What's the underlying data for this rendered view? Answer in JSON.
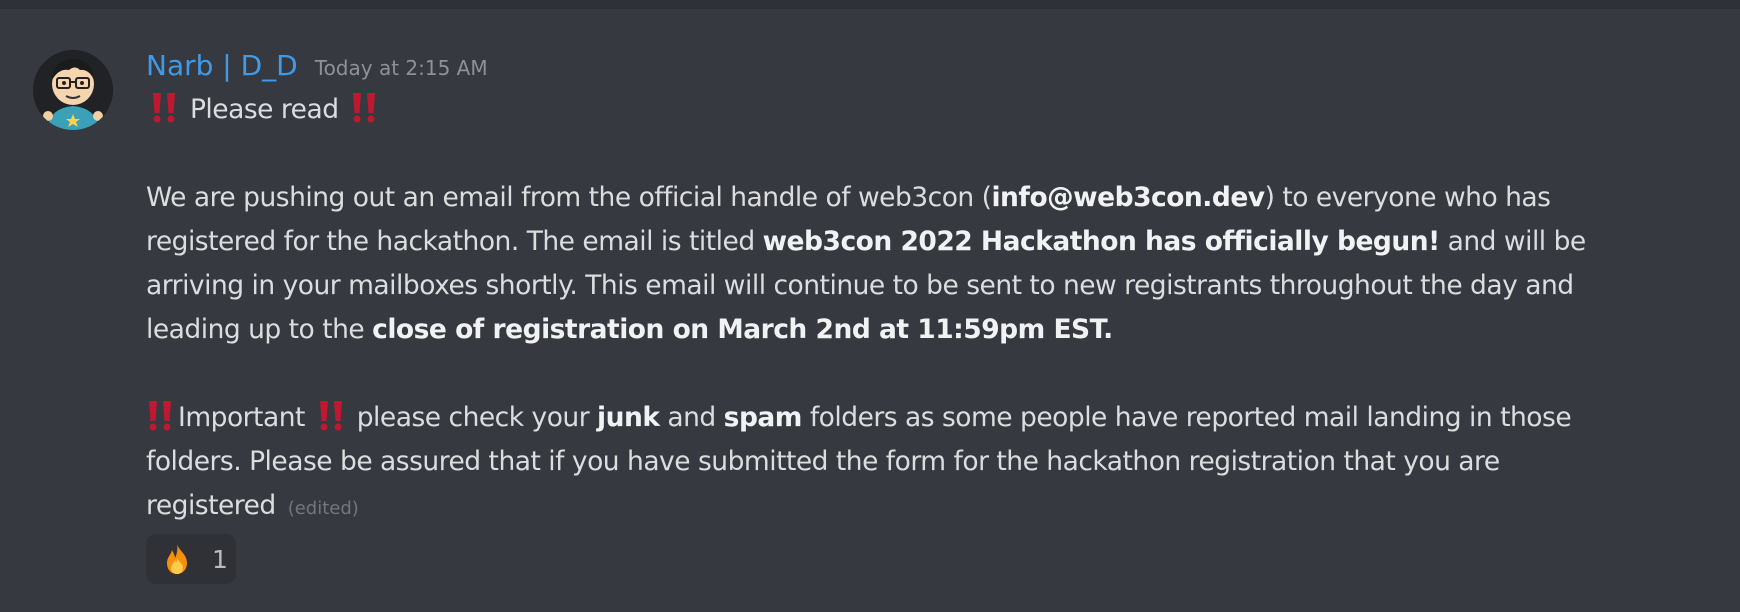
{
  "message": {
    "author": "Narb | D_D",
    "timestamp": "Today at 2:15 AM",
    "line1_text": "Please read",
    "para1": {
      "l1_a": "We are pushing out an email from the official  handle of web3con (",
      "l1_b": "info@web3con.dev",
      "l1_c": ") to everyone who has",
      "l2_a": "registered for the hackathon.  The email is titled ",
      "l2_b": "web3con 2022 Hackathon has officially begun!",
      "l2_c": " and will be",
      "l3": "arriving in your mailboxes shortly.   This email will continue to be sent to new registrants throughout the day and",
      "l4_a": "leading up to the ",
      "l4_b": "close of registration on March 2nd at 11:59pm EST."
    },
    "para2": {
      "l1_a": "Important ",
      "l1_b": " please check your ",
      "l1_c": "junk",
      "l1_d": " and ",
      "l1_e": "spam",
      "l1_f": " folders as some people have reported mail landing in those",
      "l2": "folders.  Please be assured that if you have submitted the form for the hackathon registration that you are",
      "l3": "registered",
      "edited": "(edited)"
    }
  },
  "reaction": {
    "emoji": "fire-emoji",
    "count": "1"
  },
  "colors": {
    "background": "#36393f",
    "username": "#3f9bea",
    "text": "#dcddde",
    "exclamation": "#be1931"
  }
}
